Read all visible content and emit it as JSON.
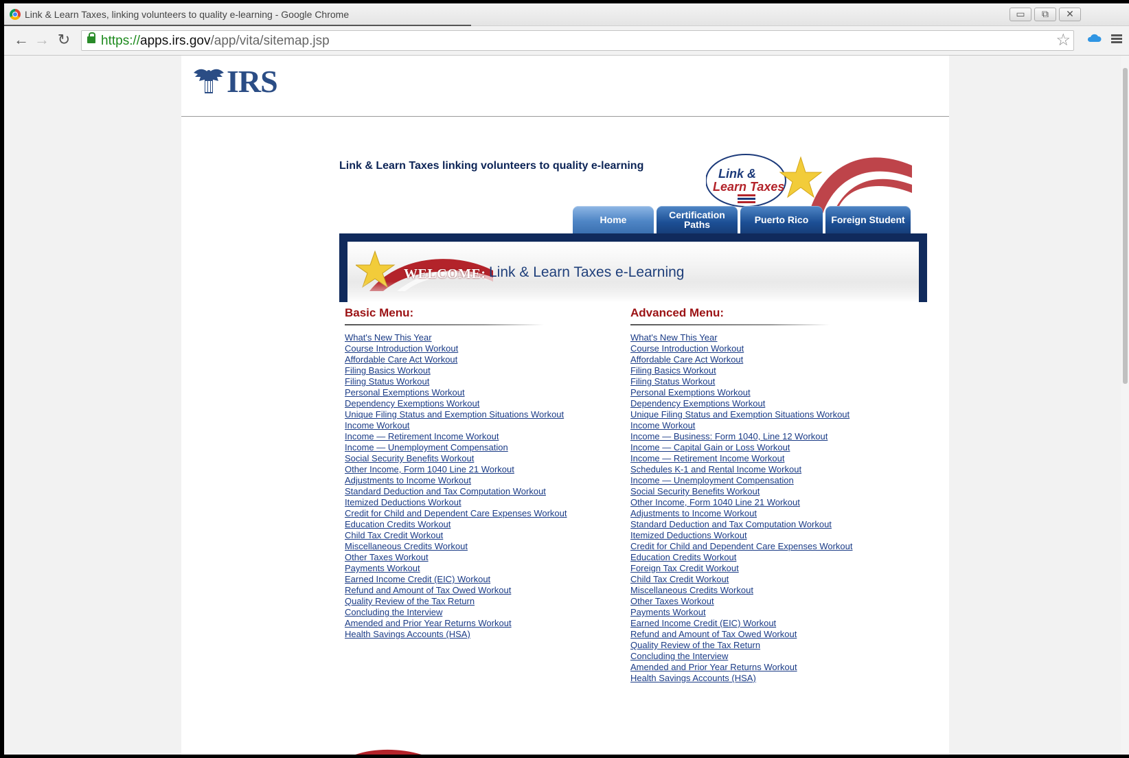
{
  "window": {
    "title": "Link & Learn Taxes, linking volunteers to quality e-learning - Google Chrome",
    "minimize": "▭",
    "restore": "⧉",
    "close": "✕"
  },
  "toolbar": {
    "back_icon": "←",
    "forward_icon": "→",
    "reload_icon": "↻",
    "url_scheme": "https://",
    "url_host": "apps.irs.gov",
    "url_path": "/app/vita/sitemap.jsp",
    "star_icon": "☆"
  },
  "header": {
    "irs_text": "IRS",
    "tagline": "Link & Learn Taxes linking volunteers to quality e-learning"
  },
  "logo": {
    "line1": "Link &",
    "line2": "Learn Taxes"
  },
  "tabs": [
    {
      "label": "Home"
    },
    {
      "label": "Certification Paths"
    },
    {
      "label": "Puerto Rico"
    },
    {
      "label": "Foreign Student"
    }
  ],
  "banner": {
    "welcome": "WELCOME:",
    "title": "Link & Learn Taxes e-Learning"
  },
  "basic_menu": {
    "title": "Basic Menu:",
    "items": [
      "What's New This Year",
      "Course Introduction Workout",
      "Affordable Care Act Workout",
      "Filing Basics Workout",
      "Filing Status Workout",
      "Personal Exemptions Workout",
      "Dependency Exemptions Workout",
      "Unique Filing Status and Exemption Situations Workout",
      "Income Workout",
      "Income — Retirement Income Workout",
      "Income — Unemployment Compensation",
      "Social Security Benefits Workout",
      "Other Income, Form 1040 Line 21 Workout",
      "Adjustments to Income Workout",
      "Standard Deduction and Tax Computation Workout",
      "Itemized Deductions Workout",
      "Credit for Child and Dependent Care Expenses Workout",
      "Education Credits Workout",
      "Child Tax Credit Workout",
      "Miscellaneous Credits Workout",
      "Other Taxes Workout",
      "Payments Workout",
      "Earned Income Credit (EIC) Workout",
      "Refund and Amount of Tax Owed Workout",
      "Quality Review of the Tax Return",
      "Concluding the Interview",
      "Amended and Prior Year Returns Workout",
      "Health Savings Accounts (HSA)"
    ]
  },
  "advanced_menu": {
    "title": "Advanced Menu:",
    "items": [
      "What's New This Year",
      "Course Introduction Workout",
      "Affordable Care Act Workout",
      "Filing Basics Workout",
      "Filing Status Workout",
      "Personal Exemptions Workout",
      "Dependency Exemptions Workout",
      "Unique Filing Status and Exemption Situations Workout",
      "Income Workout",
      "Income — Business: Form 1040, Line 12 Workout",
      "Income — Capital Gain or Loss Workout",
      "Income — Retirement Income Workout",
      "Schedules K-1 and Rental Income Workout",
      "Income — Unemployment Compensation",
      "Social Security Benefits Workout",
      "Other Income, Form 1040 Line 21 Workout",
      "Adjustments to Income Workout",
      "Standard Deduction and Tax Computation Workout",
      "Itemized Deductions Workout",
      "Credit for Child and Dependent Care Expenses Workout",
      "Education Credits Workout",
      "Foreign Tax Credit Workout",
      "Child Tax Credit Workout",
      "Miscellaneous Credits Workout",
      "Other Taxes Workout",
      "Payments Workout",
      "Earned Income Credit (EIC) Workout",
      "Refund and Amount of Tax Owed Workout",
      "Quality Review of the Tax Return",
      "Concluding the Interview",
      "Amended and Prior Year Returns Workout",
      "Health Savings Accounts (HSA)"
    ]
  },
  "colors": {
    "tab_blue": "#1c4f95",
    "menu_title_red": "#9b1214",
    "link_blue": "#1a3b86",
    "navy": "#102a5c"
  }
}
